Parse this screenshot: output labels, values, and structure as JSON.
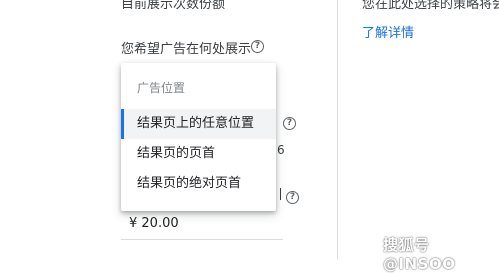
{
  "left_top_cut_text": "目前展示次数份额",
  "right_top_cut_text": "您在此处选择的策略将会",
  "learn_more_link": "了解详情",
  "question_label": "您希望广告在何处展示",
  "dropdown": {
    "header": "广告位置",
    "items": [
      {
        "label": "结果页上的任意位置",
        "selected": true
      },
      {
        "label": "结果页的页首",
        "selected": false
      },
      {
        "label": "结果页的绝对页首",
        "selected": false
      }
    ]
  },
  "behind_menu_fragment": "6",
  "amount_value": "¥ 20.00",
  "watermark": "搜狐号@INSOO",
  "colors": {
    "accent": "#1a73e8",
    "divider": "#dadce0",
    "text": "#202124",
    "muted": "#80868b"
  }
}
